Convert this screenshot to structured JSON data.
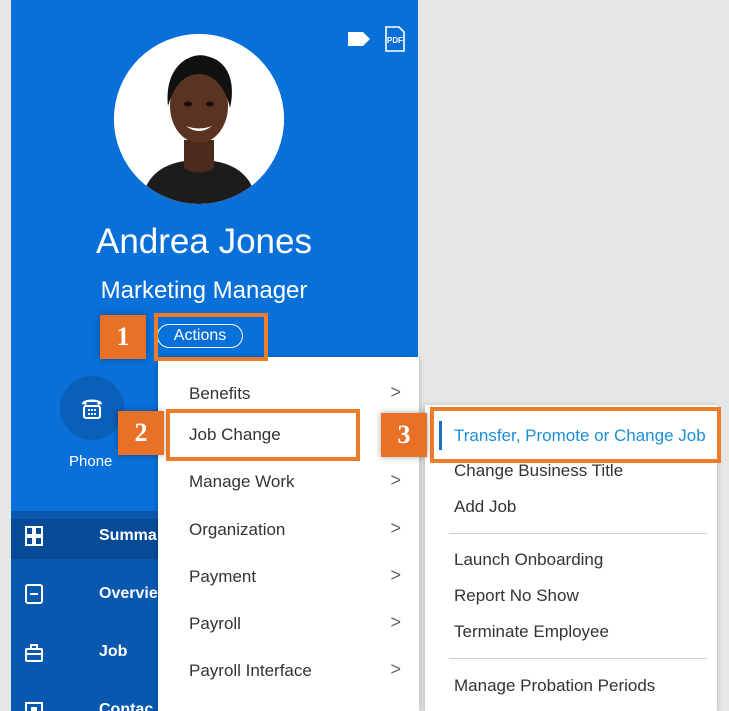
{
  "profile": {
    "name": "Andrea Jones",
    "title": "Marketing Manager",
    "actions_label": "Actions",
    "top_icons": [
      "tag-icon",
      "pdf-icon"
    ],
    "pdf_label": "PDF",
    "phone_label": "Phone",
    "nav_items": [
      {
        "label": "Summa",
        "icon": "grid-icon",
        "active": true
      },
      {
        "label": "Overvie",
        "icon": "document-icon",
        "active": false
      },
      {
        "label": "Job",
        "icon": "briefcase-icon",
        "active": false
      },
      {
        "label": "Contac",
        "icon": "contact-icon",
        "active": false
      }
    ]
  },
  "callouts": [
    {
      "number": "1"
    },
    {
      "number": "2"
    },
    {
      "number": "3"
    }
  ],
  "actions_menu": {
    "items": [
      {
        "label": "Benefits",
        "chevron": ">"
      },
      {
        "label": "Job Change",
        "chevron": ""
      },
      {
        "label": "Manage Work",
        "chevron": ">"
      },
      {
        "label": "Organization",
        "chevron": ">"
      },
      {
        "label": "Payment",
        "chevron": ">"
      },
      {
        "label": "Payroll",
        "chevron": ">"
      },
      {
        "label": "Payroll Interface",
        "chevron": ">"
      }
    ]
  },
  "job_change_submenu": {
    "items": [
      {
        "label": "Transfer, Promote or Change Job",
        "highlighted": true
      },
      {
        "label": "Change Business Title"
      },
      {
        "label": "Add Job"
      },
      {
        "label": "Launch Onboarding"
      },
      {
        "label": "Report No Show"
      },
      {
        "label": "Terminate Employee"
      },
      {
        "label": "Manage Probation Periods"
      }
    ]
  },
  "colors": {
    "profile_blue": "#0870d8",
    "nav_blue": "#0858b0",
    "callout_orange": "#ee7d2b",
    "highlight_text": "#1a8fd6"
  }
}
